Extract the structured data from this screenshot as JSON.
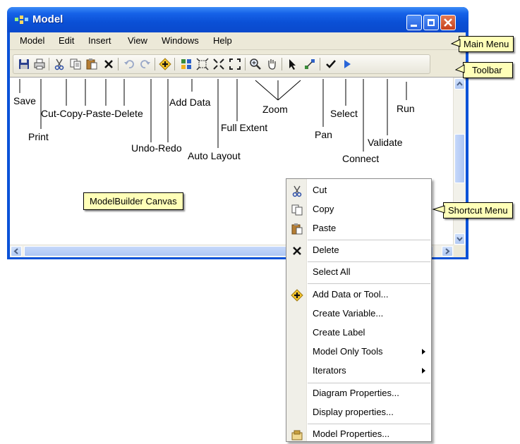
{
  "window": {
    "title": "Model"
  },
  "menu": [
    "Model",
    "Edit",
    "Insert",
    "View",
    "Windows",
    "Help"
  ],
  "toolbar": {
    "icons": [
      "save-icon",
      "print-icon",
      "cut-icon",
      "copy-icon",
      "paste-icon",
      "delete-icon",
      "undo-icon",
      "redo-icon",
      "add-data-icon",
      "auto-layout-icon",
      "full-extent-icon",
      "zoom-in-fixed-icon",
      "zoom-out-fixed-icon",
      "zoom-in-icon",
      "pan-icon",
      "select-icon",
      "connect-icon",
      "validate-icon",
      "run-icon"
    ]
  },
  "labels": {
    "save": "Save",
    "print": "Print",
    "cut_copy_paste_delete": "Cut-Copy-Paste-Delete",
    "undo_redo": "Undo-Redo",
    "add_data": "Add Data",
    "auto_layout": "Auto Layout",
    "full_extent": "Full Extent",
    "zoom": "Zoom",
    "pan": "Pan",
    "select": "Select",
    "connect": "Connect",
    "validate": "Validate",
    "run": "Run"
  },
  "callouts": {
    "main_menu": "Main Menu",
    "toolbar": "Toolbar",
    "canvas": "ModelBuilder Canvas",
    "shortcut_menu": "Shortcut Menu"
  },
  "context_menu": {
    "items": [
      {
        "label": "Cut",
        "icon": "cut-icon"
      },
      {
        "label": "Copy",
        "icon": "copy-icon"
      },
      {
        "label": "Paste",
        "icon": "paste-icon"
      },
      {
        "label": "Delete",
        "icon": "delete-icon"
      },
      {
        "label": "Select All",
        "icon": ""
      },
      {
        "label": "Add Data or Tool...",
        "icon": "add-data-icon"
      },
      {
        "label": "Create Variable...",
        "icon": ""
      },
      {
        "label": "Create Label",
        "icon": ""
      },
      {
        "label": "Model Only Tools",
        "icon": "",
        "submenu": true
      },
      {
        "label": "Iterators",
        "icon": "",
        "submenu": true
      },
      {
        "label": "Diagram Properties...",
        "icon": ""
      },
      {
        "label": "Display properties...",
        "icon": ""
      },
      {
        "label": "Model Properties...",
        "icon": "model-properties-icon"
      }
    ]
  },
  "colors": {
    "titlebar": "#0a50d6",
    "callout_bg": "#ffffb8",
    "menu_bg": "#ece9d8"
  }
}
